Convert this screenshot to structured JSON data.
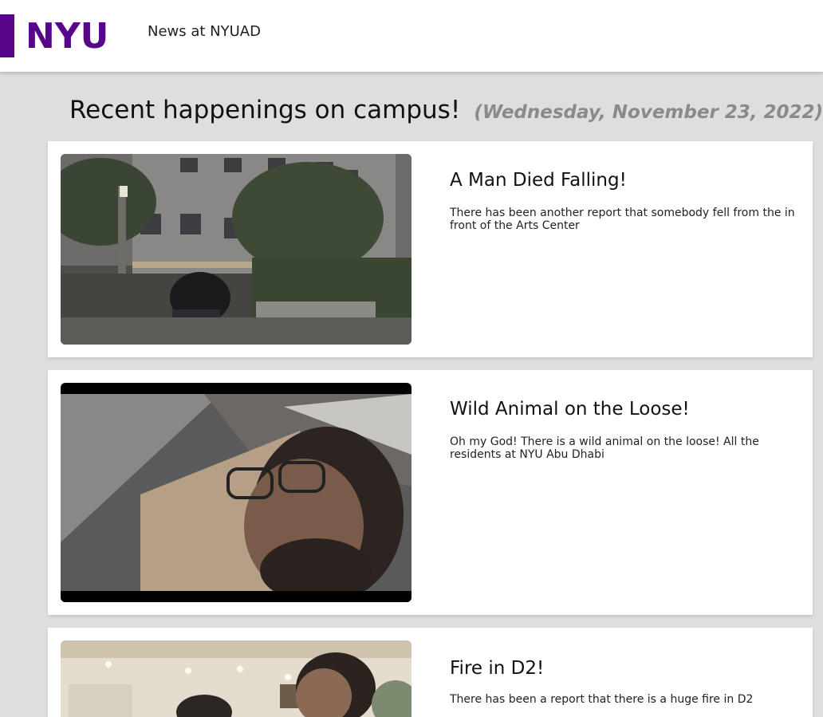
{
  "header": {
    "logo_text": "NYU",
    "site_link_label": "News at NYUAD",
    "brand_color": "#57068c"
  },
  "page": {
    "heading": "Recent happenings on campus!",
    "date": "(Wednesday, November 23, 2022)"
  },
  "articles": [
    {
      "title": "A Man Died Falling!",
      "description": "There has been another report that somebody fell from the in front of the Arts Center"
    },
    {
      "title": "Wild Animal on the Loose!",
      "description": "Oh my God! There is a wild animal on the loose! All the residents at NYU Abu Dhabi"
    },
    {
      "title": "Fire in D2!",
      "description": "There has been a report that there is a huge fire in D2"
    }
  ]
}
